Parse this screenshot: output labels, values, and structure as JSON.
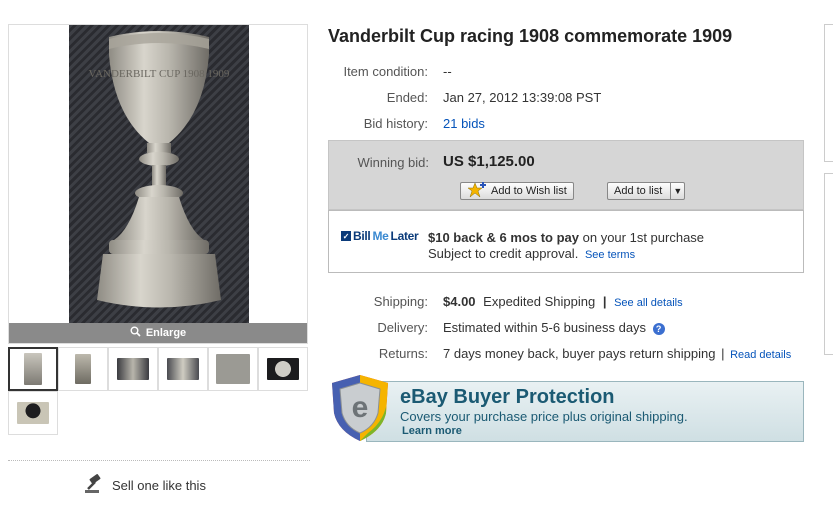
{
  "gallery": {
    "enlarge_label": "Enlarge",
    "main_photo_engraving": "VANDERBILT CUP 1908 1909"
  },
  "sell_like_label": "Sell one like this",
  "item": {
    "title": "Vanderbilt Cup racing 1908 commemorate 1909",
    "condition_label": "Item condition:",
    "condition_value": "--",
    "ended_label": "Ended:",
    "ended_value": "Jan 27, 2012 13:39:08 PST",
    "bid_history_label": "Bid history:",
    "bid_history_value": "21 bids"
  },
  "bid": {
    "winning_label": "Winning bid:",
    "winning_value": "US $1,125.00",
    "wishlist_button": "Add to Wish list",
    "addlist_button": "Add to list"
  },
  "billmelater": {
    "logo_bill": "Bill",
    "logo_me": "Me",
    "logo_later": "Later",
    "offer_bold": "$10 back & 6 mos to pay",
    "offer_rest": " on your 1st purchase",
    "subject": "Subject to credit approval.",
    "see_terms": "See terms"
  },
  "shipping": {
    "shipping_label": "Shipping:",
    "shipping_price": "$4.00",
    "shipping_method": "Expedited Shipping",
    "see_all": "See all details",
    "delivery_label": "Delivery:",
    "delivery_value": "Estimated within 5-6 business days",
    "returns_label": "Returns:",
    "returns_value": "7 days money back, buyer pays return shipping",
    "read_details": "Read details"
  },
  "protection": {
    "title": "eBay Buyer Protection",
    "subtitle": "Covers your purchase price plus original shipping.",
    "learn_more": "Learn more"
  }
}
